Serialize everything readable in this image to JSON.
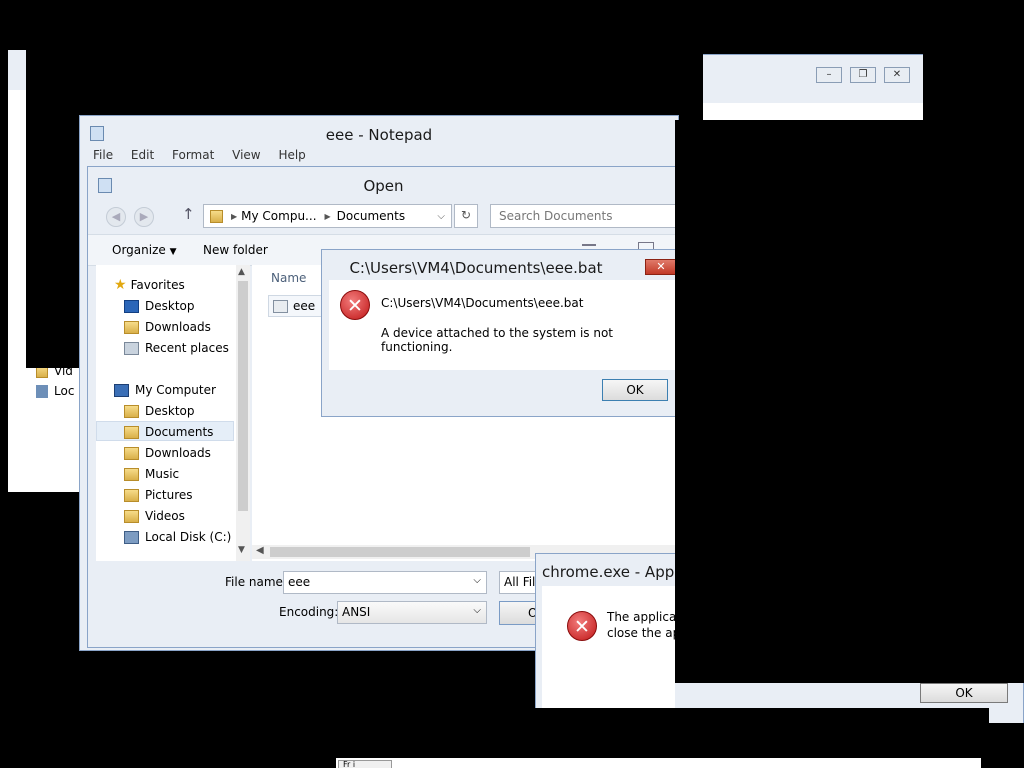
{
  "notepad": {
    "title": "eee - Notepad",
    "menu": [
      "File",
      "Edit",
      "Format",
      "View",
      "Help"
    ]
  },
  "open_dialog": {
    "title": "Open",
    "breadcrumb": [
      "My Compu...",
      "Documents"
    ],
    "search_placeholder": "Search Documents",
    "toolbar": {
      "organize": "Organize",
      "new_folder": "New folder"
    },
    "column_name": "Name",
    "files": [
      "eee"
    ],
    "favorites_label": "Favorites",
    "favorites": [
      "Desktop",
      "Downloads",
      "Recent places"
    ],
    "computer_label": "My Computer",
    "computer_items": [
      "Desktop",
      "Documents",
      "Downloads",
      "Music",
      "Pictures",
      "Videos",
      "Local Disk (C:)"
    ],
    "file_name_label": "File name:",
    "file_name_value": "eee",
    "file_type_value": "All File",
    "encoding_label": "Encoding:",
    "encoding_value": "ANSI",
    "open_button_partial": "O"
  },
  "error_dialog": {
    "title": "C:\\Users\\VM4\\Documents\\eee.bat",
    "path": "C:\\Users\\VM4\\Documents\\eee.bat",
    "message": "A device attached to the system is not functioning.",
    "ok": "OK"
  },
  "chrome_dialog": {
    "title": "chrome.exe - Applic",
    "line1": "The applicati",
    "line2": "close the app",
    "ok": "OK"
  },
  "background_window": {
    "items": [
      "Vid",
      "Loc"
    ]
  },
  "bottom_partial": {
    "text": "Fr i"
  }
}
